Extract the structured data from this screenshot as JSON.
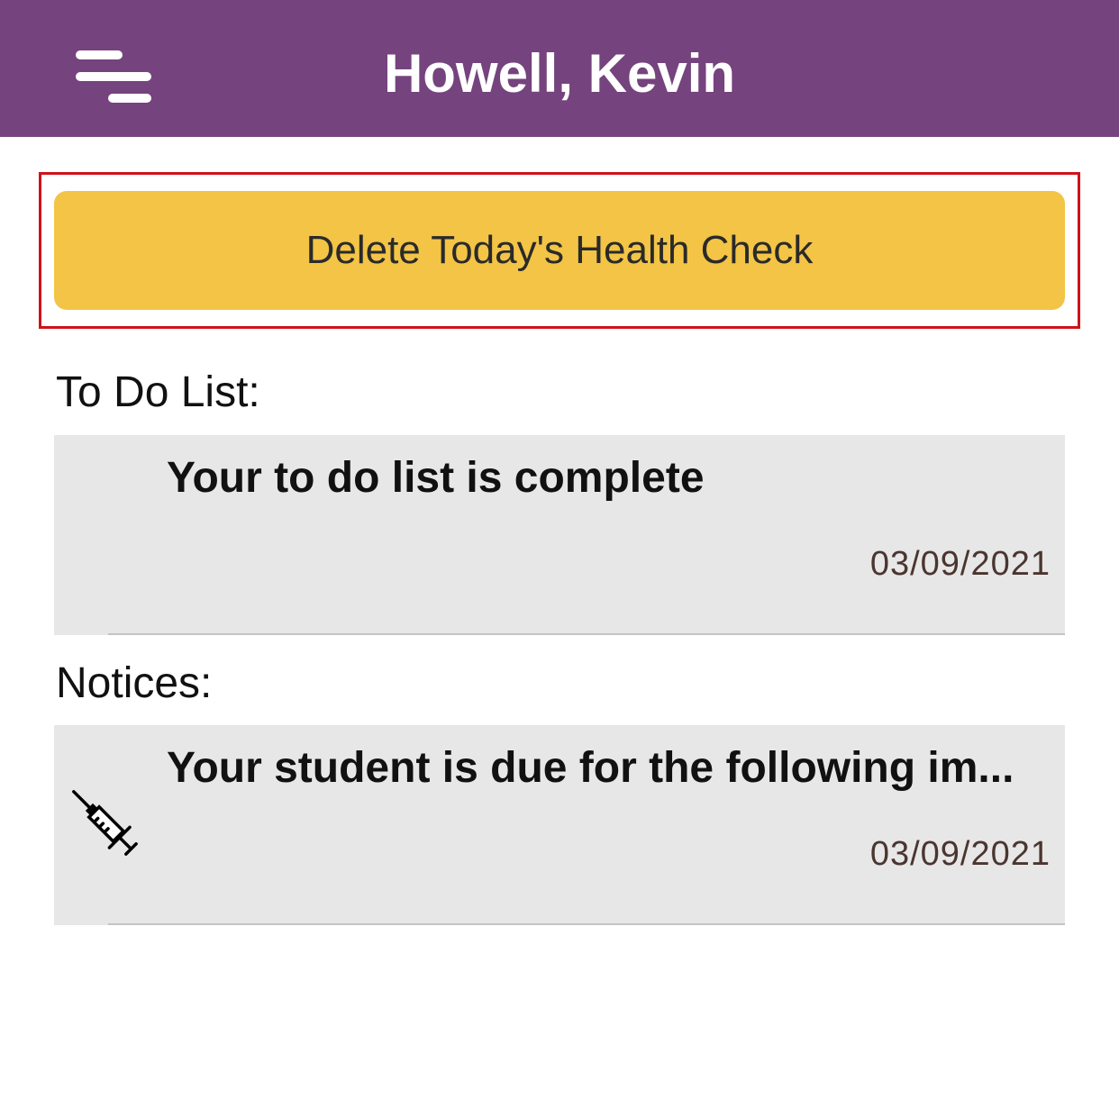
{
  "header": {
    "title": "Howell, Kevin",
    "menu_icon": "menu-icon",
    "background_color": "#75437d"
  },
  "action_button": {
    "label": "Delete Today's Health Check",
    "color": "#f3c445",
    "highlight_color": "#d0121a"
  },
  "todo": {
    "section_label": "To Do List:",
    "items": [
      {
        "title": "Your to do list is complete",
        "date": "03/09/2021",
        "icon": ""
      }
    ]
  },
  "notices": {
    "section_label": "Notices:",
    "items": [
      {
        "title": "Your student is due for the following im...",
        "date": "03/09/2021",
        "icon": "syringe-icon"
      }
    ]
  }
}
